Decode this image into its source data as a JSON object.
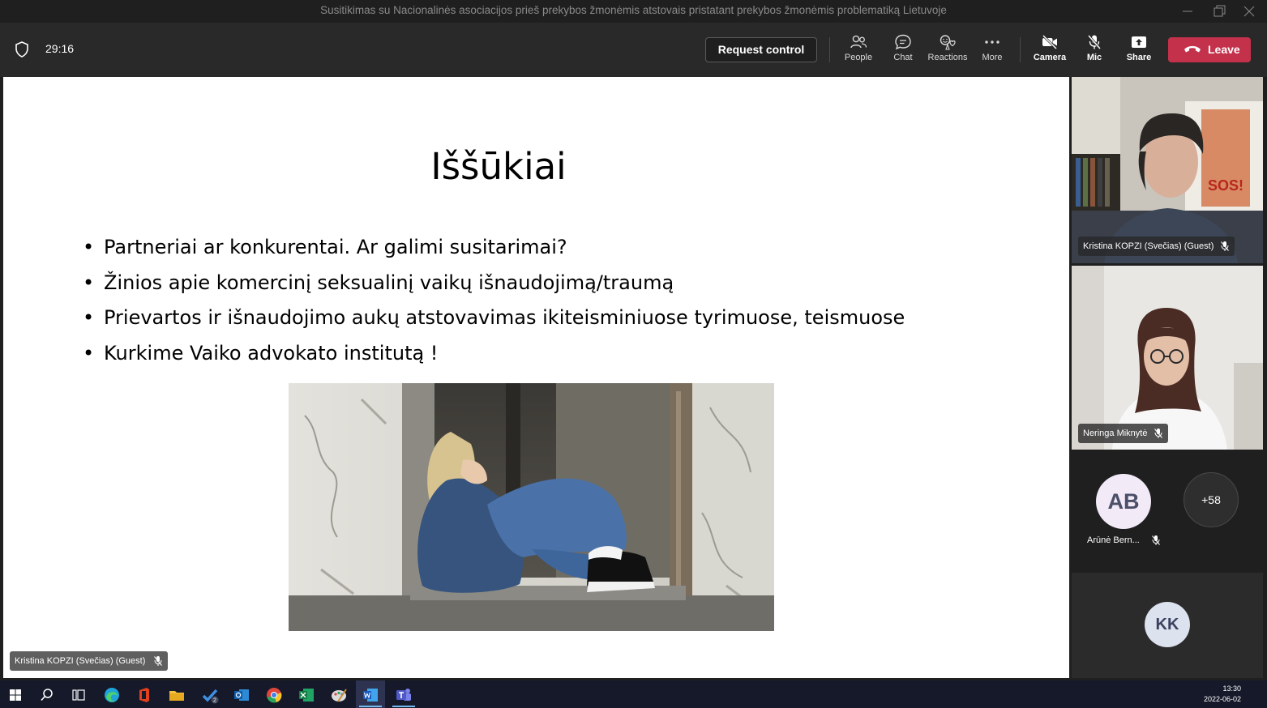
{
  "window": {
    "title": "Susitikimas su Nacionalinės asociacijos prieš prekybos žmonėmis atstovais pristatant prekybos žmonėmis problematiką Lietuvoje"
  },
  "toolbar": {
    "timer": "29:16",
    "request_control": "Request control",
    "people": "People",
    "chat": "Chat",
    "reactions": "Reactions",
    "more": "More",
    "camera": "Camera",
    "mic": "Mic",
    "share": "Share",
    "leave": "Leave"
  },
  "slide": {
    "title": "Iššūkiai",
    "bullet_glyph": "•",
    "bullets": [
      "Partneriai ar konkurentai. Ar galimi susitarimai?",
      "Žinios apie komercinį seksualinį vaikų išnaudojimą/traumą",
      "Prievartos ir išnaudojimo aukų atstovavimas ikiteisminiuose tyrimuose, teismuose",
      "Kurkime Vaiko advokato institutą !"
    ],
    "presenter_label": "Kristina KOPZI (Svečias) (Guest)"
  },
  "participants": {
    "tile1_name": "Kristina KOPZI (Svečias) (Guest)",
    "tile2_name": "Neringa Miknytė",
    "avatar_ab_initials": "AB",
    "avatar_ab_name": "Arūnė Bern...",
    "overflow_count": "+58",
    "avatar_kk_initials": "KK"
  },
  "taskbar": {
    "time": "13:30",
    "date": "2022-06-02",
    "todo_badge": "2"
  },
  "colors": {
    "leave_red": "#c4314b",
    "toolbar_bg": "#292929",
    "avatar_ab_bg": "#f2eaf7",
    "avatar_kk_bg": "#dde2ef"
  }
}
